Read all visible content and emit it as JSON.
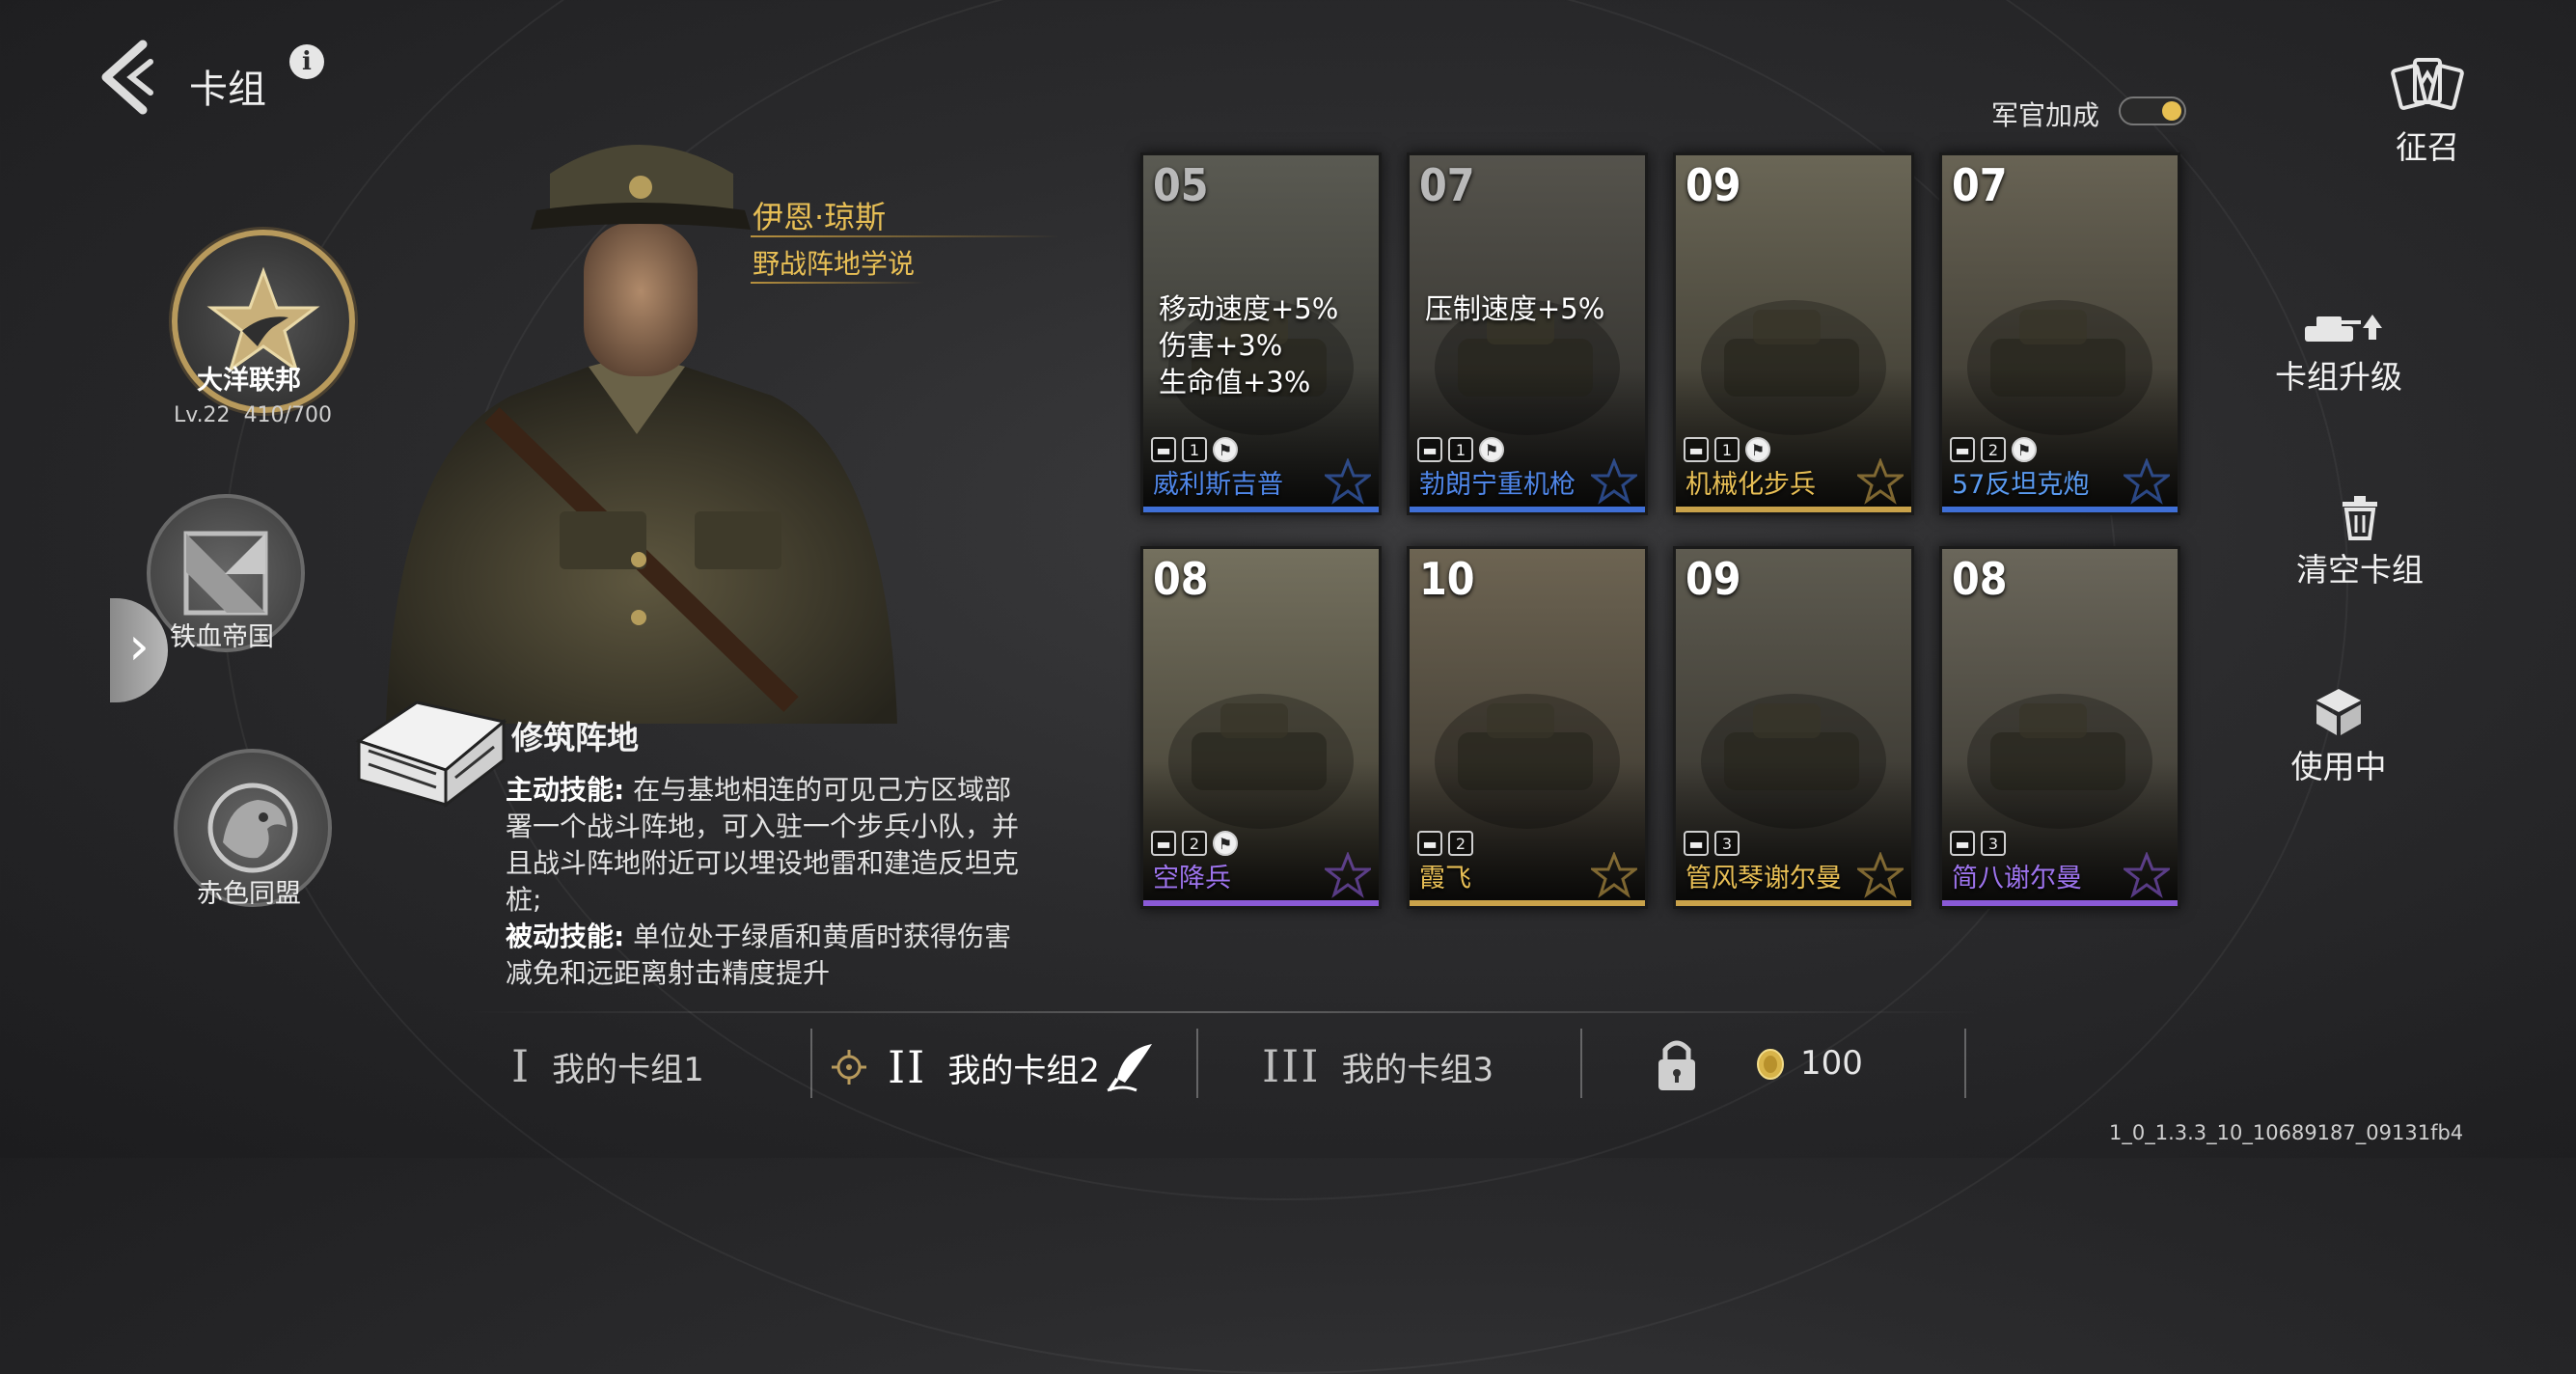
{
  "header": {
    "title": "卡组",
    "info_icon": "info-icon",
    "back_icon": "back-chevron-icon"
  },
  "factions": [
    {
      "name": "大洋联邦",
      "level": "Lv.22",
      "xp": "410/700",
      "active": true
    },
    {
      "name": "铁血帝国",
      "active": false
    },
    {
      "name": "赤色同盟",
      "active": false
    }
  ],
  "officer": {
    "name": "伊恩·琼斯",
    "doctrine": "野战阵地学说",
    "skill_title": "修筑阵地",
    "active_label": "主动技能:",
    "active_text": "在与基地相连的可见己方区域部署一个战斗阵地，可入驻一个步兵小队，并且战斗阵地附近可以埋设地雷和建造反坦克桩;",
    "passive_label": "被动技能:",
    "passive_text": "单位处于绿盾和黄盾时获得伤害减免和远距离射击精度提升"
  },
  "officer_bonus": {
    "label": "军官加成",
    "enabled": true
  },
  "cards": [
    {
      "cost": "05",
      "name": "威利斯吉普",
      "count": "1",
      "buff": [
        "移动速度+5%",
        "伤害+3%",
        "生命值+3%"
      ],
      "rarity_color": "#3f6fd6",
      "name_color": "#4f86e8",
      "dim": true
    },
    {
      "cost": "07",
      "name": "勃朗宁重机枪",
      "count": "1",
      "buff": [
        "压制速度+5%"
      ],
      "rarity_color": "#3f6fd6",
      "name_color": "#4f86e8",
      "dim": true
    },
    {
      "cost": "09",
      "name": "机械化步兵",
      "count": "1",
      "buff": [],
      "rarity_color": "#c9a24a",
      "name_color": "#e8bf55",
      "dim": false
    },
    {
      "cost": "07",
      "name": "57反坦克炮",
      "count": "2",
      "buff": [],
      "rarity_color": "#3f6fd6",
      "name_color": "#5a9af0",
      "dim": false
    },
    {
      "cost": "08",
      "name": "空降兵",
      "count": "2",
      "buff": [],
      "rarity_color": "#8a5ad6",
      "name_color": "#9e74ee",
      "dim": false
    },
    {
      "cost": "10",
      "name": "霞飞",
      "count": "2",
      "buff": [],
      "rarity_color": "#c9a24a",
      "name_color": "#e8bf55",
      "dim": false
    },
    {
      "cost": "09",
      "name": "管风琴谢尔曼",
      "count": "3",
      "buff": [],
      "rarity_color": "#c9a24a",
      "name_color": "#e8bf55",
      "dim": false
    },
    {
      "cost": "08",
      "name": "简八谢尔曼",
      "count": "3",
      "buff": [],
      "rarity_color": "#8a5ad6",
      "name_color": "#9e74ee",
      "dim": false
    }
  ],
  "side_menu": {
    "recruit": "征召",
    "upgrade": "卡组升级",
    "clear": "清空卡组",
    "in_use": "使用中"
  },
  "deck_tabs": [
    {
      "num": "I",
      "label": "我的卡组1",
      "active": false
    },
    {
      "num": "II",
      "label": "我的卡组2",
      "active": true
    },
    {
      "num": "III",
      "label": "我的卡组3",
      "active": false
    }
  ],
  "currency": {
    "value": "100",
    "icon": "gold-coin-icon"
  },
  "version": "1_0_1.3.3_10_10689187_09131fb4"
}
